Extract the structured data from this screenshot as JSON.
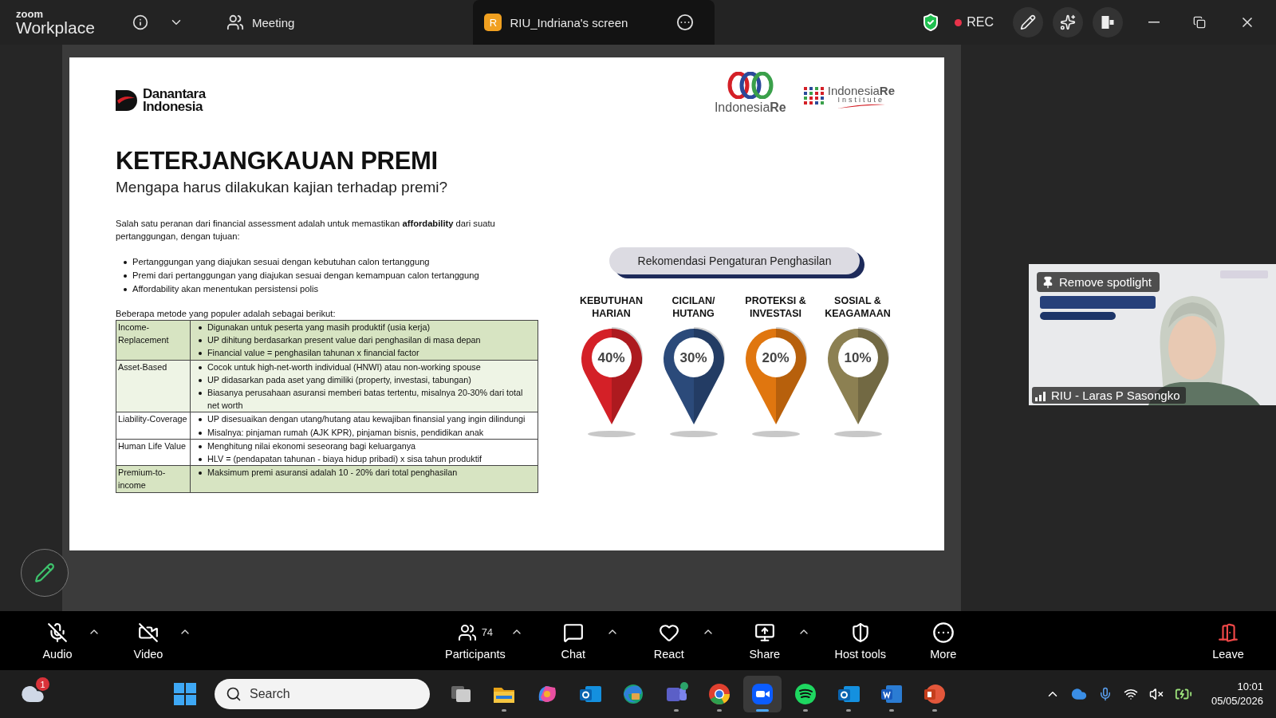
{
  "top_bar": {
    "logo": {
      "brand": "zoom",
      "product": "Workplace"
    },
    "tabs": [
      {
        "label": "Meeting",
        "selected": false
      },
      {
        "label": "RIU_Indriana's screen",
        "badge": "R",
        "selected": true
      }
    ],
    "recording": {
      "label": "REC",
      "on": true
    }
  },
  "slide": {
    "logo_left": [
      "Danantara",
      "Indonesia"
    ],
    "logo_right": "Indonesia**Re**",
    "logo_institute": {
      "name": "Indonesia**Re**",
      "sub": "Institute"
    },
    "title": "KETERJANGKAUAN PREMI",
    "subtitle": "Mengapa harus dilakukan kajian terhadap premi?",
    "intro": "Salah satu peranan dari financial assessment adalah untuk memastikan **affordability** dari suatu pertanggungan, dengan tujuan:",
    "goals": [
      "Pertanggungan yang diajukan sesuai dengan kebutuhan calon tertanggung",
      "Premi dari pertanggungan yang diajukan sesuai dengan kemampuan calon tertanggung",
      "Affordability akan menentukan persistensi polis"
    ],
    "methods_intro": "Beberapa metode yang populer adalah sebagai berikut:",
    "methods": [
      {
        "name": "Income-Replacement",
        "color": "#d7e4c2",
        "points": [
          "Digunakan untuk peserta yang masih produktif (usia kerja)",
          "UP dihitung berdasarkan present value dari penghasilan di masa depan",
          "Financial value = penghasilan tahunan x financial factor"
        ]
      },
      {
        "name": "Asset-Based",
        "color": "#eef4e5",
        "points": [
          "Cocok untuk high-net-worth individual (HNWI) atau non-working spouse",
          "UP didasarkan pada aset yang dimiliki (property, investasi, tabungan)",
          "Biasanya perusahaan asuransi memberi batas tertentu, misalnya 20-30% dari total net worth"
        ]
      },
      {
        "name": "Liability-Coverage",
        "color": "#ffffff",
        "points": [
          "UP disesuaikan dengan utang/hutang atau kewajiban finansial yang ingin dilindungi",
          "Misalnya: pinjaman rumah (AJK KPR), pinjaman bisnis, pendidikan anak"
        ]
      },
      {
        "name": "Human Life Value",
        "color": "#ffffff",
        "points": [
          "Menghitung nilai ekonomi seseorang bagi keluarganya",
          "HLV = (pendapatan tahunan - biaya hidup pribadi) x sisa tahun produktif"
        ]
      },
      {
        "name": "Premium-to-income",
        "color": "#d7e4c2",
        "points": [
          "Maksimum premi asuransi adalah 10 - 20% dari total penghasilan"
        ]
      }
    ],
    "recommendation": {
      "button": "Rekomendasi Pengaturan Penghasilan",
      "pins": [
        {
          "label": [
            "KEBUTUHAN",
            "HARIAN"
          ],
          "value": "40%",
          "color": "#d42027"
        },
        {
          "label": [
            "CICILAN/",
            "HUTANG"
          ],
          "value": "30%",
          "color": "#2b4a7a"
        },
        {
          "label": [
            "PROTEKSI &",
            "INVESTASI"
          ],
          "value": "20%",
          "color": "#e0760f"
        },
        {
          "label": [
            "SOSIAL &",
            "KEAGAMAAN"
          ],
          "value": "10%",
          "color": "#8c8052"
        }
      ]
    }
  },
  "video_tile": {
    "spotlight_button": "Remove spotlight",
    "name": "RIU - Laras P Sasongko"
  },
  "toolbar": {
    "items": [
      {
        "label": "Audio",
        "kind": "audio",
        "off": true,
        "caret": true
      },
      {
        "label": "Video",
        "kind": "video",
        "off": true,
        "caret": true
      },
      {
        "label": "Participants",
        "kind": "participants",
        "count": "74",
        "off": false,
        "caret": true
      },
      {
        "label": "Chat",
        "kind": "chat",
        "off": false,
        "caret": true
      },
      {
        "label": "React",
        "kind": "react",
        "off": false,
        "caret": true
      },
      {
        "label": "Share",
        "kind": "share",
        "off": false,
        "caret": true
      },
      {
        "label": "Host tools",
        "kind": "host",
        "off": false,
        "caret": false
      },
      {
        "label": "More",
        "kind": "more",
        "off": false,
        "caret": false
      }
    ],
    "leave": "Leave"
  },
  "taskbar": {
    "weather_badge": "1",
    "search": {
      "placeholder": "Search"
    },
    "apps": [
      {
        "kind": "task-view",
        "running": false,
        "selected": false
      },
      {
        "kind": "folder",
        "running": true,
        "selected": false
      },
      {
        "kind": "copilot",
        "running": false,
        "selected": false
      },
      {
        "kind": "mail",
        "running": false,
        "selected": false
      },
      {
        "kind": "edge",
        "running": false,
        "selected": false
      },
      {
        "kind": "teams",
        "running": true,
        "selected": false
      },
      {
        "kind": "chrome",
        "running": true,
        "selected": false
      },
      {
        "kind": "zoom",
        "running": true,
        "selected": true
      },
      {
        "kind": "music",
        "running": true,
        "selected": false
      },
      {
        "kind": "mail",
        "running": true,
        "selected": false
      },
      {
        "kind": "word",
        "running": true,
        "selected": false
      },
      {
        "kind": "slides",
        "running": true,
        "selected": false
      }
    ],
    "clock": {
      "time": "10:01",
      "date": "05/05/2026"
    }
  }
}
